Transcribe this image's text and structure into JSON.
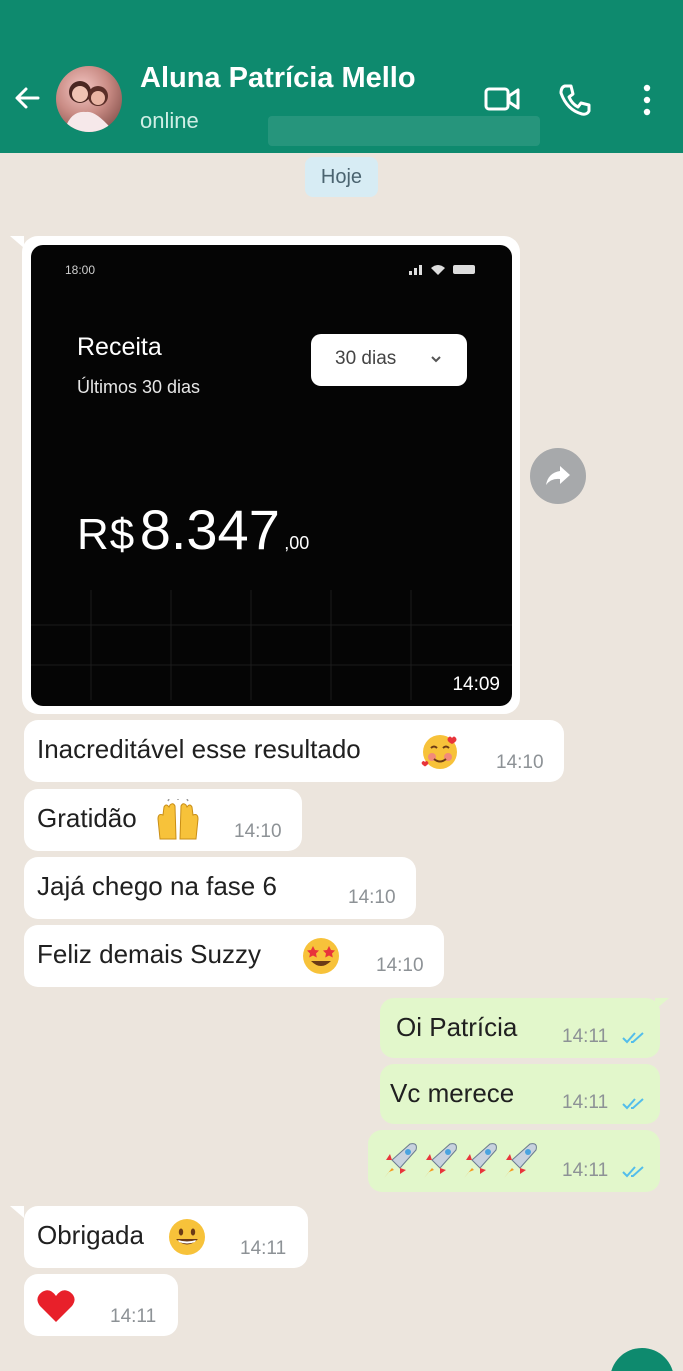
{
  "header": {
    "contact_name": "Aluna Patrícia Mello",
    "status": "online",
    "icons": [
      "back-arrow-icon",
      "video-call-icon",
      "phone-call-icon",
      "more-vert-icon"
    ]
  },
  "chat": {
    "date_chip": "Hoje",
    "image_message": {
      "screenshot": {
        "clock": "18:00",
        "title": "Receita",
        "subtitle": "Últimos 30 dias",
        "range_select": "30 dias",
        "currency": "R$",
        "amount": "8.347",
        "cents": ",00"
      },
      "time": "14:09"
    },
    "messages": [
      {
        "dir": "in",
        "text": "Inacreditável esse resultado",
        "emoji": "smiling-face-with-hearts",
        "time": "14:10"
      },
      {
        "dir": "in",
        "text": "Gratidão",
        "emoji": "raising-hands",
        "time": "14:10"
      },
      {
        "dir": "in",
        "text": "Jajá chego na fase 6",
        "time": "14:10"
      },
      {
        "dir": "in",
        "text": "Feliz demais Suzzy",
        "emoji": "star-struck",
        "time": "14:10"
      },
      {
        "dir": "out",
        "text": "Oi Patrícia",
        "time": "14:11",
        "status": "read"
      },
      {
        "dir": "out",
        "text": "Vc merece",
        "time": "14:11",
        "status": "read"
      },
      {
        "dir": "out",
        "text": "",
        "emoji": "rocket x4",
        "time": "14:11",
        "status": "read"
      },
      {
        "dir": "in",
        "text": "Obrigada",
        "emoji": "grinning-face",
        "time": "14:11"
      },
      {
        "dir": "in",
        "text": "",
        "emoji": "red-heart",
        "time": "14:11"
      }
    ]
  },
  "colors": {
    "header_bg": "#0e8a6e",
    "chat_bg": "#ece5dd",
    "outgoing_bubble": "#e2f7cb",
    "read_ticks": "#53bdeb"
  }
}
